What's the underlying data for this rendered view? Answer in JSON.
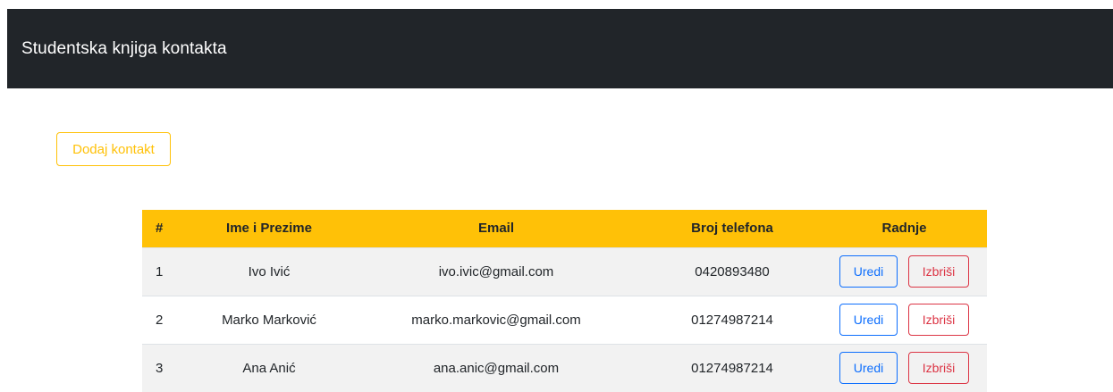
{
  "navbar": {
    "brand": "Studentska knjiga kontakta"
  },
  "toolbar": {
    "add_label": "Dodaj kontakt"
  },
  "table": {
    "headers": {
      "num": "#",
      "name": "Ime i Prezime",
      "email": "Email",
      "phone": "Broj telefona",
      "actions": "Radnje"
    },
    "rows": [
      {
        "num": "1",
        "name": "Ivo Ivić",
        "email": "ivo.ivic@gmail.com",
        "phone": "0420893480"
      },
      {
        "num": "2",
        "name": "Marko Marković",
        "email": "marko.markovic@gmail.com",
        "phone": "01274987214"
      },
      {
        "num": "3",
        "name": "Ana Anić",
        "email": "ana.anic@gmail.com",
        "phone": "01274987214"
      }
    ],
    "edit_label": "Uredi",
    "delete_label": "Izbriši"
  },
  "colors": {
    "navbar_bg": "#212529",
    "accent_warning": "#ffc107",
    "primary": "#0d6efd",
    "danger": "#dc3545",
    "striped_row": "#f2f2f2"
  }
}
